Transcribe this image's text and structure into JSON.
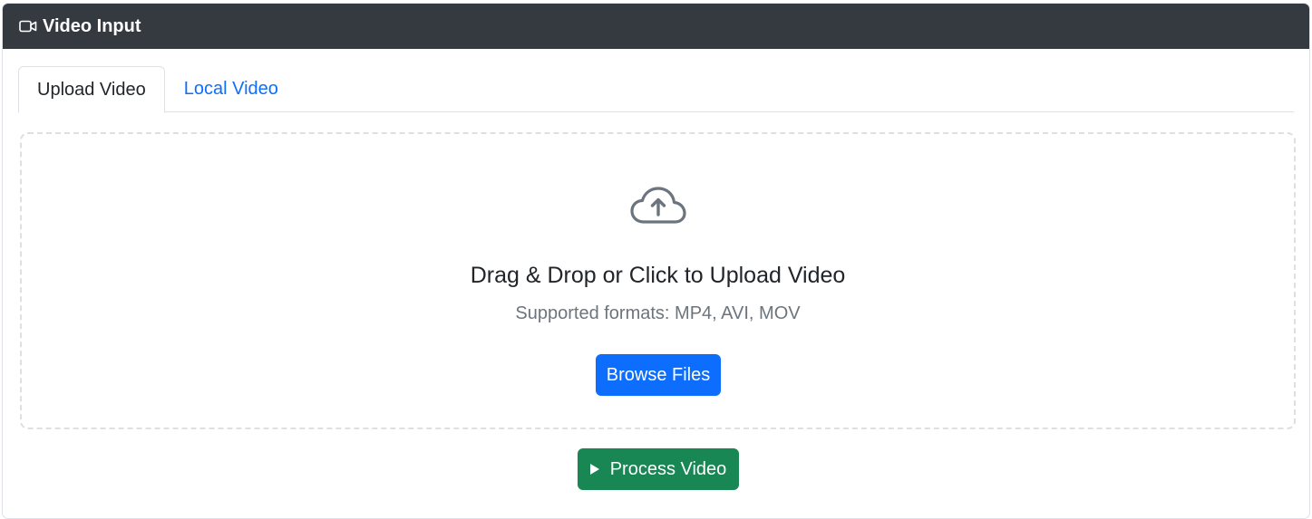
{
  "header": {
    "title": "Video Input",
    "icon": "video-camera-icon"
  },
  "tabs": [
    {
      "label": "Upload Video",
      "active": true
    },
    {
      "label": "Local Video",
      "active": false
    }
  ],
  "dropzone": {
    "icon": "cloud-upload-icon",
    "title": "Drag & Drop or Click to Upload Video",
    "subtitle": "Supported formats: MP4, AVI, MOV",
    "browse_label": "Browse Files"
  },
  "process": {
    "icon": "play-icon",
    "label": "Process Video"
  },
  "colors": {
    "header_bg": "#343a40",
    "primary": "#0d6efd",
    "success": "#198754",
    "muted": "#6c757d"
  }
}
